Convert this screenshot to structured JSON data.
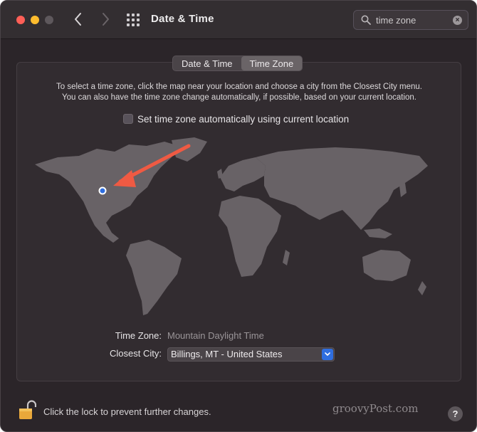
{
  "window": {
    "title": "Date & Time"
  },
  "toolbar": {
    "back_icon": "chevron-left-icon",
    "forward_icon": "chevron-right-icon",
    "grid_icon": "show-all-grid-icon"
  },
  "search": {
    "value": "time zone",
    "icon": "magnifying-glass-icon",
    "clear_icon": "clear-icon"
  },
  "tabs": [
    {
      "label": "Date & Time",
      "active": false
    },
    {
      "label": "Time Zone",
      "active": true
    }
  ],
  "instructions": {
    "line1": "To select a time zone, click the map near your location and choose a city from the Closest City menu.",
    "line2": "You can also have the time zone change automatically, if possible, based on your current location."
  },
  "auto_timezone": {
    "label": "Set time zone automatically using current location",
    "checked": false
  },
  "time_zone": {
    "label": "Time Zone:",
    "value": "Mountain Daylight Time"
  },
  "closest_city": {
    "label": "Closest City:",
    "value": "Billings, MT - United States"
  },
  "footer": {
    "lock_text": "Click the lock to prevent further changes.",
    "help_label": "?"
  },
  "watermark": "groovyPost.com",
  "colors": {
    "accent": "#2f6ee0",
    "annotation_arrow": "#ef5a43",
    "map_land": "#686266"
  }
}
